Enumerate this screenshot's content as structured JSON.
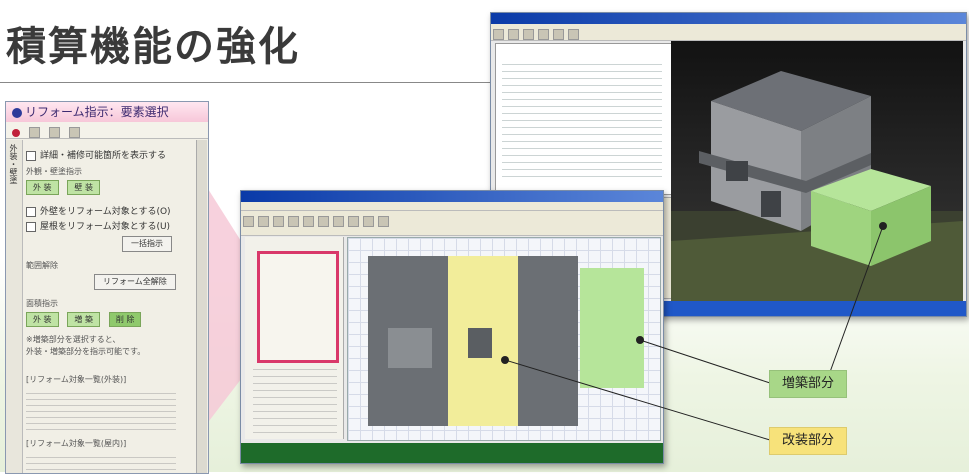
{
  "title": "積算機能の強化",
  "left_panel": {
    "window_title": "リフォーム指示：要素選択",
    "checkbox_1": "詳細・補修可能箇所を表示する",
    "section_exterior": "外観・壁塗指示",
    "btn_exterior_a": "外 装",
    "btn_exterior_b": "壁 装",
    "checkbox_2": "外壁をリフォーム対象とする(O)",
    "checkbox_3": "屋根をリフォーム対象とする(U)",
    "btn_bulk": "一括指示",
    "section_range": "範囲解除",
    "btn_reform_clear": "リフォーム全解除",
    "section_area": "面積指示",
    "btn_area_a": "外 装",
    "btn_area_b": "増 築",
    "btn_area_c": "削 除",
    "note_line1": "※増築部分を選択すると、",
    "note_line2": "外装・増築部分を指示可能です。",
    "section_list1": "[リフォーム対象一覧(外装)]",
    "section_list2": "[リフォーム対象一覧(屋内)]",
    "side_tab": "外装・壁塗"
  },
  "callouts": {
    "addition": "増築部分",
    "renovation": "改装部分"
  },
  "colors": {
    "addition": "#a8d788",
    "renovation": "#f7e27a",
    "highlight": "#d9386a"
  }
}
